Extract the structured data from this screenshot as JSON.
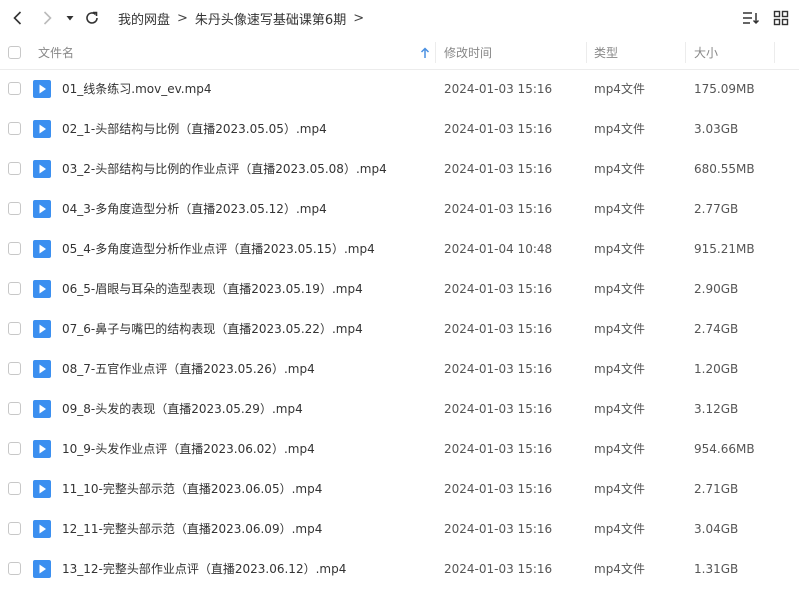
{
  "toolbar": {
    "back_icon": "chevron-left-icon",
    "forward_icon": "chevron-right-icon",
    "dropdown_icon": "triangle-down-icon",
    "refresh_icon": "refresh-icon",
    "sort_icon": "sort-list-icon",
    "grid_icon": "grid-view-icon"
  },
  "breadcrumb": {
    "root": "我的网盘",
    "current": "朱丹头像速写基础课第6期",
    "separator": ">"
  },
  "columns": {
    "name": "文件名",
    "modified": "修改时间",
    "type": "类型",
    "size": "大小",
    "sort_icon": "arrow-up-icon",
    "accent": "#4a90e2"
  },
  "file_icon_color": "#3b8ff0",
  "files": [
    {
      "name": "01_线条练习.mov_ev.mp4",
      "modified": "2024-01-03 15:16",
      "type": "mp4文件",
      "size": "175.09MB"
    },
    {
      "name": "02_1-头部结构与比例（直播2023.05.05）.mp4",
      "modified": "2024-01-03 15:16",
      "type": "mp4文件",
      "size": "3.03GB"
    },
    {
      "name": "03_2-头部结构与比例的作业点评（直播2023.05.08）.mp4",
      "modified": "2024-01-03 15:16",
      "type": "mp4文件",
      "size": "680.55MB"
    },
    {
      "name": "04_3-多角度造型分析（直播2023.05.12）.mp4",
      "modified": "2024-01-03 15:16",
      "type": "mp4文件",
      "size": "2.77GB"
    },
    {
      "name": "05_4-多角度造型分析作业点评（直播2023.05.15）.mp4",
      "modified": "2024-01-04 10:48",
      "type": "mp4文件",
      "size": "915.21MB"
    },
    {
      "name": "06_5-眉眼与耳朵的造型表现（直播2023.05.19）.mp4",
      "modified": "2024-01-03 15:16",
      "type": "mp4文件",
      "size": "2.90GB"
    },
    {
      "name": "07_6-鼻子与嘴巴的结构表现（直播2023.05.22）.mp4",
      "modified": "2024-01-03 15:16",
      "type": "mp4文件",
      "size": "2.74GB"
    },
    {
      "name": "08_7-五官作业点评（直播2023.05.26）.mp4",
      "modified": "2024-01-03 15:16",
      "type": "mp4文件",
      "size": "1.20GB"
    },
    {
      "name": "09_8-头发的表现（直播2023.05.29）.mp4",
      "modified": "2024-01-03 15:16",
      "type": "mp4文件",
      "size": "3.12GB"
    },
    {
      "name": "10_9-头发作业点评（直播2023.06.02）.mp4",
      "modified": "2024-01-03 15:16",
      "type": "mp4文件",
      "size": "954.66MB"
    },
    {
      "name": "11_10-完整头部示范（直播2023.06.05）.mp4",
      "modified": "2024-01-03 15:16",
      "type": "mp4文件",
      "size": "2.71GB"
    },
    {
      "name": "12_11-完整头部示范（直播2023.06.09）.mp4",
      "modified": "2024-01-03 15:16",
      "type": "mp4文件",
      "size": "3.04GB"
    },
    {
      "name": "13_12-完整头部作业点评（直播2023.06.12）.mp4",
      "modified": "2024-01-03 15:16",
      "type": "mp4文件",
      "size": "1.31GB"
    }
  ]
}
